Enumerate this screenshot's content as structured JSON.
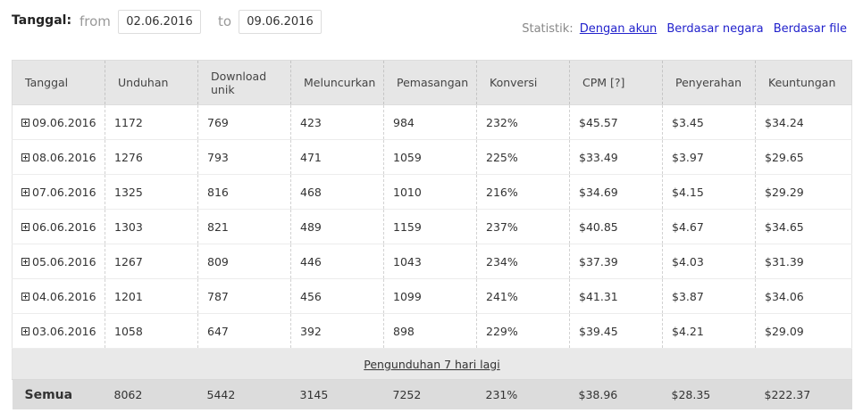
{
  "filter": {
    "label": "Tanggal:",
    "from_label": "from",
    "from_value": "02.06.2016",
    "to_label": "to",
    "to_value": "09.06.2016"
  },
  "stats": {
    "label": "Statistik:",
    "links": [
      "Dengan akun",
      "Berdasar negara",
      "Berdasar file"
    ]
  },
  "table": {
    "headers": [
      "Tanggal",
      "Unduhan",
      "Download unik",
      "Meluncurkan",
      "Pemasangan",
      "Konversi",
      "CPM [?]",
      "Penyerahan",
      "Keuntungan"
    ],
    "rows": [
      [
        "09.06.2016",
        "1172",
        "769",
        "423",
        "984",
        "232%",
        "$45.57",
        "$3.45",
        "$34.24"
      ],
      [
        "08.06.2016",
        "1276",
        "793",
        "471",
        "1059",
        "225%",
        "$33.49",
        "$3.97",
        "$29.65"
      ],
      [
        "07.06.2016",
        "1325",
        "816",
        "468",
        "1010",
        "216%",
        "$34.69",
        "$4.15",
        "$29.29"
      ],
      [
        "06.06.2016",
        "1303",
        "821",
        "489",
        "1159",
        "237%",
        "$40.85",
        "$4.67",
        "$34.65"
      ],
      [
        "05.06.2016",
        "1267",
        "809",
        "446",
        "1043",
        "234%",
        "$37.39",
        "$4.03",
        "$31.39"
      ],
      [
        "04.06.2016",
        "1201",
        "787",
        "456",
        "1099",
        "241%",
        "$41.31",
        "$3.87",
        "$34.06"
      ],
      [
        "03.06.2016",
        "1058",
        "647",
        "392",
        "898",
        "229%",
        "$39.45",
        "$4.21",
        "$29.09"
      ]
    ],
    "more_link": "Pengunduhan 7 hari lagi",
    "total": [
      "Semua",
      "8062",
      "5442",
      "3145",
      "7252",
      "231%",
      "$38.96",
      "$28.35",
      "$222.37"
    ]
  }
}
